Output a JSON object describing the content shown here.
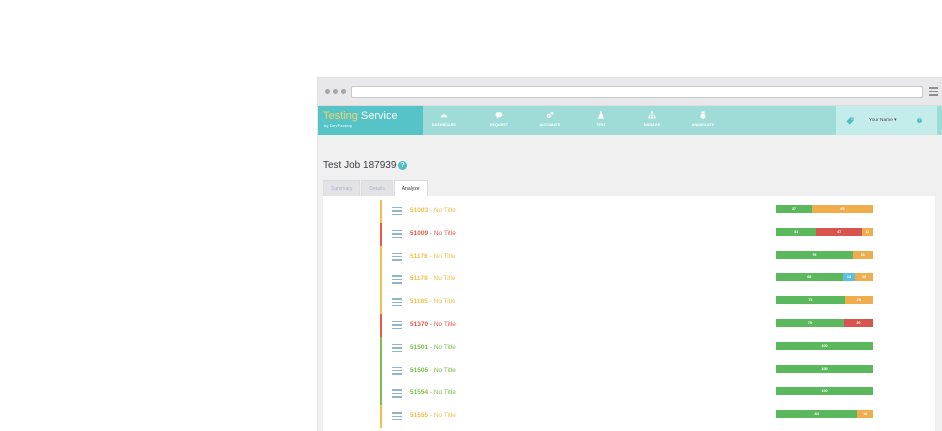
{
  "app": {
    "brand_first": "Testing",
    "brand_second": " Service",
    "brand_by": "by DevFactory",
    "nav": [
      {
        "label": "DASHBOARD",
        "icon": "dashboard-icon"
      },
      {
        "label": "REQUEST",
        "icon": "chat-bubble-icon"
      },
      {
        "label": "AUTOMATE",
        "icon": "gears-icon"
      },
      {
        "label": "TEST",
        "icon": "flask-icon"
      },
      {
        "label": "MANAGE",
        "icon": "hierarchy-icon"
      },
      {
        "label": "ANNIHILATE",
        "icon": "bomb-icon"
      }
    ],
    "user_name": "Your Name ▾",
    "help_small": "?"
  },
  "colors": {
    "brand_bg": "#56c4c7",
    "nav_bg": "#9fdcd7",
    "pass": "#5cb85c",
    "warn": "#f0ad4e",
    "fail": "#d9534f",
    "info": "#5bc0de",
    "title_yellow": "#f0c04e",
    "title_red": "#e8594a",
    "title_green": "#7cc24a"
  },
  "page": {
    "title": "Test Job 187939",
    "help_big": "?",
    "tabs": [
      {
        "label": "Summary",
        "active": false
      },
      {
        "label": "Details",
        "active": false
      },
      {
        "label": "Analyze",
        "active": true
      }
    ]
  },
  "rows": [
    {
      "id": "51003",
      "title": " - No Title",
      "status": "warn",
      "segments": [
        {
          "v": 37,
          "label": "37",
          "c": "pass"
        },
        {
          "v": 63,
          "label": "63",
          "c": "warn"
        }
      ]
    },
    {
      "id": "51009",
      "title": " - No Title",
      "status": "fail",
      "segments": [
        {
          "v": 41,
          "label": "41",
          "c": "pass"
        },
        {
          "v": 47,
          "label": "47",
          "c": "fail"
        },
        {
          "v": 11,
          "label": "11",
          "c": "warn"
        }
      ]
    },
    {
      "id": "51176",
      "title": " - No Title",
      "status": "warn",
      "segments": [
        {
          "v": 79,
          "label": "79",
          "c": "pass"
        },
        {
          "v": 21,
          "label": "21",
          "c": "warn"
        }
      ]
    },
    {
      "id": "51178",
      "title": " - No Title",
      "status": "warn",
      "segments": [
        {
          "v": 68,
          "label": "68",
          "c": "pass"
        },
        {
          "v": 13,
          "label": "13",
          "c": "info"
        },
        {
          "v": 18,
          "label": "18",
          "c": "warn"
        }
      ]
    },
    {
      "id": "51185",
      "title": " - No Title",
      "status": "warn",
      "segments": [
        {
          "v": 71,
          "label": "71",
          "c": "pass"
        },
        {
          "v": 29,
          "label": "29",
          "c": "warn"
        }
      ]
    },
    {
      "id": "51370",
      "title": " - No Title",
      "status": "fail",
      "segments": [
        {
          "v": 70,
          "label": "70",
          "c": "pass"
        },
        {
          "v": 30,
          "label": "30",
          "c": "fail"
        }
      ]
    },
    {
      "id": "51501",
      "title": " - No Title",
      "status": "pass",
      "segments": [
        {
          "v": 100,
          "label": "100",
          "c": "pass"
        }
      ]
    },
    {
      "id": "51505",
      "title": " - No Title",
      "status": "pass",
      "segments": [
        {
          "v": 100,
          "label": "100",
          "c": "pass"
        }
      ]
    },
    {
      "id": "51554",
      "title": " - No Title",
      "status": "pass",
      "segments": [
        {
          "v": 100,
          "label": "100",
          "c": "pass"
        }
      ]
    },
    {
      "id": "51555",
      "title": " - No Title",
      "status": "warn",
      "segments": [
        {
          "v": 84,
          "label": "84",
          "c": "pass"
        },
        {
          "v": 16,
          "label": "16",
          "c": "warn"
        }
      ]
    }
  ]
}
